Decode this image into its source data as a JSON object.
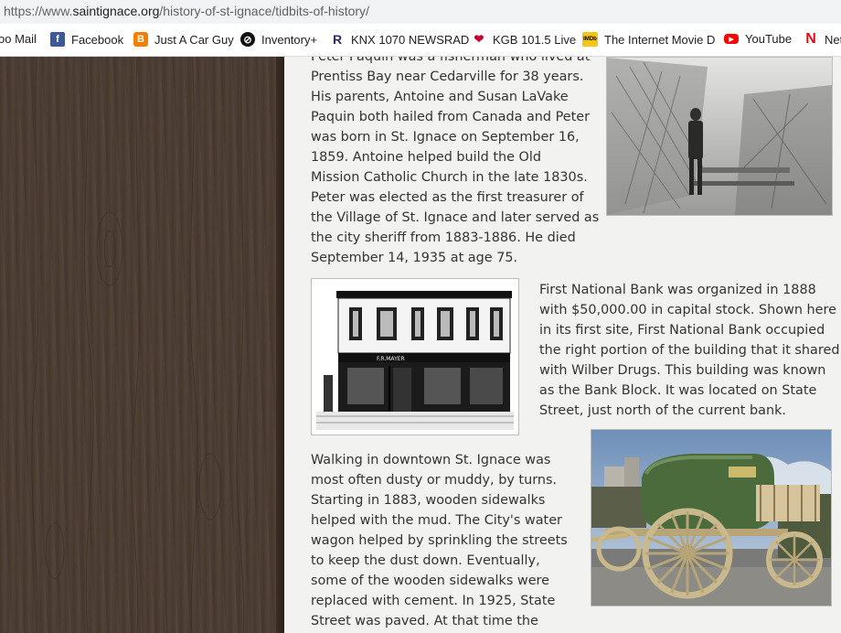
{
  "browser": {
    "url_prefix": "https://www.",
    "url_host": "saintignace.org",
    "url_path": "/history-of-st-ignace/tidbits-of-history/"
  },
  "bookmarks": [
    {
      "label": "oo Mail",
      "icon": "mail-icon"
    },
    {
      "label": "Facebook",
      "icon": "facebook-icon",
      "color": "#3b5998"
    },
    {
      "label": "Just A Car Guy",
      "icon": "blogger-icon",
      "color": "#f57d00"
    },
    {
      "label": "Inventory+",
      "icon": "inventory-icon",
      "color": "#111111"
    },
    {
      "label": "KNX 1070 NEWSRAD",
      "icon": "knx-icon",
      "color": "#2a2a6e"
    },
    {
      "label": "KGB 101.5 Live",
      "icon": "iheart-icon",
      "color": "#c6002b"
    },
    {
      "label": "The Internet Movie D",
      "icon": "imdb-icon",
      "color": "#f5c518"
    },
    {
      "label": "YouTube",
      "icon": "youtube-icon",
      "color": "#ff0000"
    },
    {
      "label": "Net",
      "icon": "netflix-icon",
      "color": "#e50914"
    }
  ],
  "article": {
    "paquin_lines": [
      "Peter Paquin was a fisherman who lived at",
      "Prentiss Bay near Cedarville for 38 years.",
      "His parents, Antoine and Susan LaVake",
      "Paquin both hailed from Canada and Peter",
      "was born in St. Ignace on September 16,",
      "1859.  Antoine helped build the Old",
      "Mission Catholic Church in the late 1830s.",
      "Peter was elected as the first treasurer of",
      "the Village of St. Ignace and later served as",
      "the city sheriff from 1883-1886.  He died",
      "September 14, 1935 at age 75."
    ],
    "bank_lines": [
      "First National Bank was organized in 1888",
      "with $50,000.00 in capital stock.  Shown here",
      "in its first site, First National Bank occupied",
      "the right portion of the building that it shared",
      "with Wilber Drugs. This building was known",
      "as the Bank Block.  It was located on State",
      "Street, just north of the current bank."
    ],
    "sidewalk_lines": [
      "Walking in downtown St. Ignace was",
      "most often dusty or muddy, by turns.",
      "Starting in 1883,  wooden sidewalks",
      "helped with the mud.  The City's water",
      "wagon helped by sprinkling the streets",
      "to keep the dust down.  Eventually,",
      "some of the wooden sidewalks were",
      "replaced with cement.  In 1925, State",
      "Street was paved.  At that time the"
    ],
    "bank_sign_text": "F.R.MAYER"
  }
}
